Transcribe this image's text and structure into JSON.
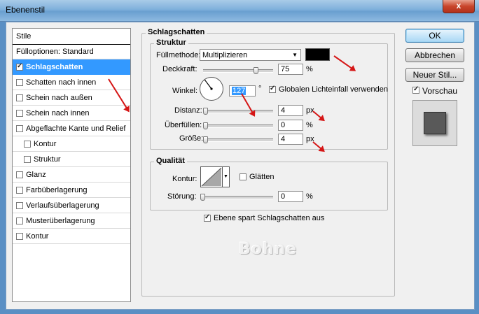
{
  "window": {
    "title": "Ebenenstil",
    "close_glyph": "x"
  },
  "styles_panel": {
    "header": "Stile",
    "items": [
      {
        "label": "Fülloptionen: Standard",
        "checkbox": false
      },
      {
        "label": "Schlagschatten",
        "checkbox": true,
        "checked": true,
        "selected": true
      },
      {
        "label": "Schatten nach innen",
        "checkbox": true,
        "checked": false
      },
      {
        "label": "Schein nach außen",
        "checkbox": true,
        "checked": false
      },
      {
        "label": "Schein nach innen",
        "checkbox": true,
        "checked": false
      },
      {
        "label": "Abgeflachte Kante und Relief",
        "checkbox": true,
        "checked": false
      },
      {
        "label": "Kontur",
        "checkbox": true,
        "checked": false,
        "indent": true
      },
      {
        "label": "Struktur",
        "checkbox": true,
        "checked": false,
        "indent": true
      },
      {
        "label": "Glanz",
        "checkbox": true,
        "checked": false
      },
      {
        "label": "Farbüberlagerung",
        "checkbox": true,
        "checked": false
      },
      {
        "label": "Verlaufsüberlagerung",
        "checkbox": true,
        "checked": false
      },
      {
        "label": "Musterüberlagerung",
        "checkbox": true,
        "checked": false
      },
      {
        "label": "Kontur",
        "checkbox": true,
        "checked": false
      }
    ]
  },
  "drop_shadow": {
    "section_title": "Schlagschatten",
    "structure": {
      "title": "Struktur",
      "blend_mode_label": "Füllmethode:",
      "blend_mode_value": "Multiplizieren",
      "shadow_color": "#000000",
      "opacity_label": "Deckkraft:",
      "opacity_value": "75",
      "opacity_unit": "%",
      "opacity_level": 0.75,
      "angle_label": "Winkel:",
      "angle_value": "127",
      "angle_unit": "°",
      "global_light_label": "Globalen Lichteinfall verwenden",
      "global_light_checked": true,
      "distance_label": "Distanz:",
      "distance_value": "4",
      "distance_unit": "px",
      "spread_label": "Überfüllen:",
      "spread_value": "0",
      "spread_unit": "%",
      "size_label": "Größe:",
      "size_value": "4",
      "size_unit": "px"
    },
    "quality": {
      "title": "Qualität",
      "contour_label": "Kontur:",
      "antialias_label": "Glätten",
      "antialias_checked": false,
      "noise_label": "Störung:",
      "noise_value": "0",
      "noise_unit": "%"
    },
    "layer_knockout_label": "Ebene spart Schlagschatten aus",
    "layer_knockout_checked": true
  },
  "watermark": "Bohne",
  "buttons": {
    "ok": "OK",
    "cancel": "Abbrechen",
    "new_style": "Neuer Stil...",
    "preview_label": "Vorschau",
    "preview_checked": true
  },
  "colors": {
    "selection": "#3399ff",
    "annotation_arrow": "#d51616"
  }
}
